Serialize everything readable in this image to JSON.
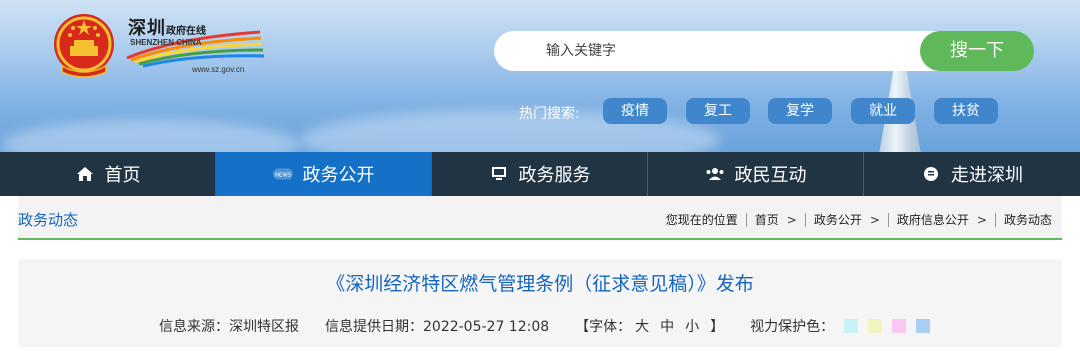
{
  "header": {
    "logo": {
      "chars": "深圳",
      "chars_small": "政府在线",
      "english": "SHENZHEN CHINA",
      "url": "www.sz.gov.cn"
    },
    "search": {
      "placeholder": "输入关键字",
      "button_label": "搜一下"
    },
    "hot_search": {
      "label": "热门搜索:",
      "tags": [
        "疫情",
        "复工",
        "复学",
        "就业",
        "扶贫"
      ]
    }
  },
  "nav": {
    "items": [
      {
        "label": "首页",
        "icon": "home-icon",
        "active": false
      },
      {
        "label": "政务公开",
        "icon": "news-icon",
        "active": true
      },
      {
        "label": "政务服务",
        "icon": "monitor-icon",
        "active": false
      },
      {
        "label": "政民互动",
        "icon": "people-icon",
        "active": false
      },
      {
        "label": "走进深圳",
        "icon": "chat-icon",
        "active": false
      }
    ]
  },
  "breadcrumb": {
    "section_title": "政务动态",
    "location_label": "您现在的位置",
    "path": [
      "首页",
      "政务公开",
      "政府信息公开",
      "政务动态"
    ]
  },
  "article": {
    "title": "《深圳经济特区燃气管理条例（征求意见稿）》发布",
    "source": "信息来源：深圳特区报",
    "date": "信息提供日期：2022-05-27 12:08",
    "font_label": "【字体：",
    "font_sizes": [
      "大",
      "中",
      "小"
    ],
    "font_close": "】",
    "eye_care_label": "视力保护色：",
    "eye_care_colors": [
      "#c8f2f8",
      "#f3f3c0",
      "#f6c8f2",
      "#a9cdf5"
    ]
  },
  "colors": {
    "nav_bg": "#213444",
    "nav_active": "#1570c8",
    "accent_green": "#5fb95a",
    "link_blue": "#1565c0"
  }
}
